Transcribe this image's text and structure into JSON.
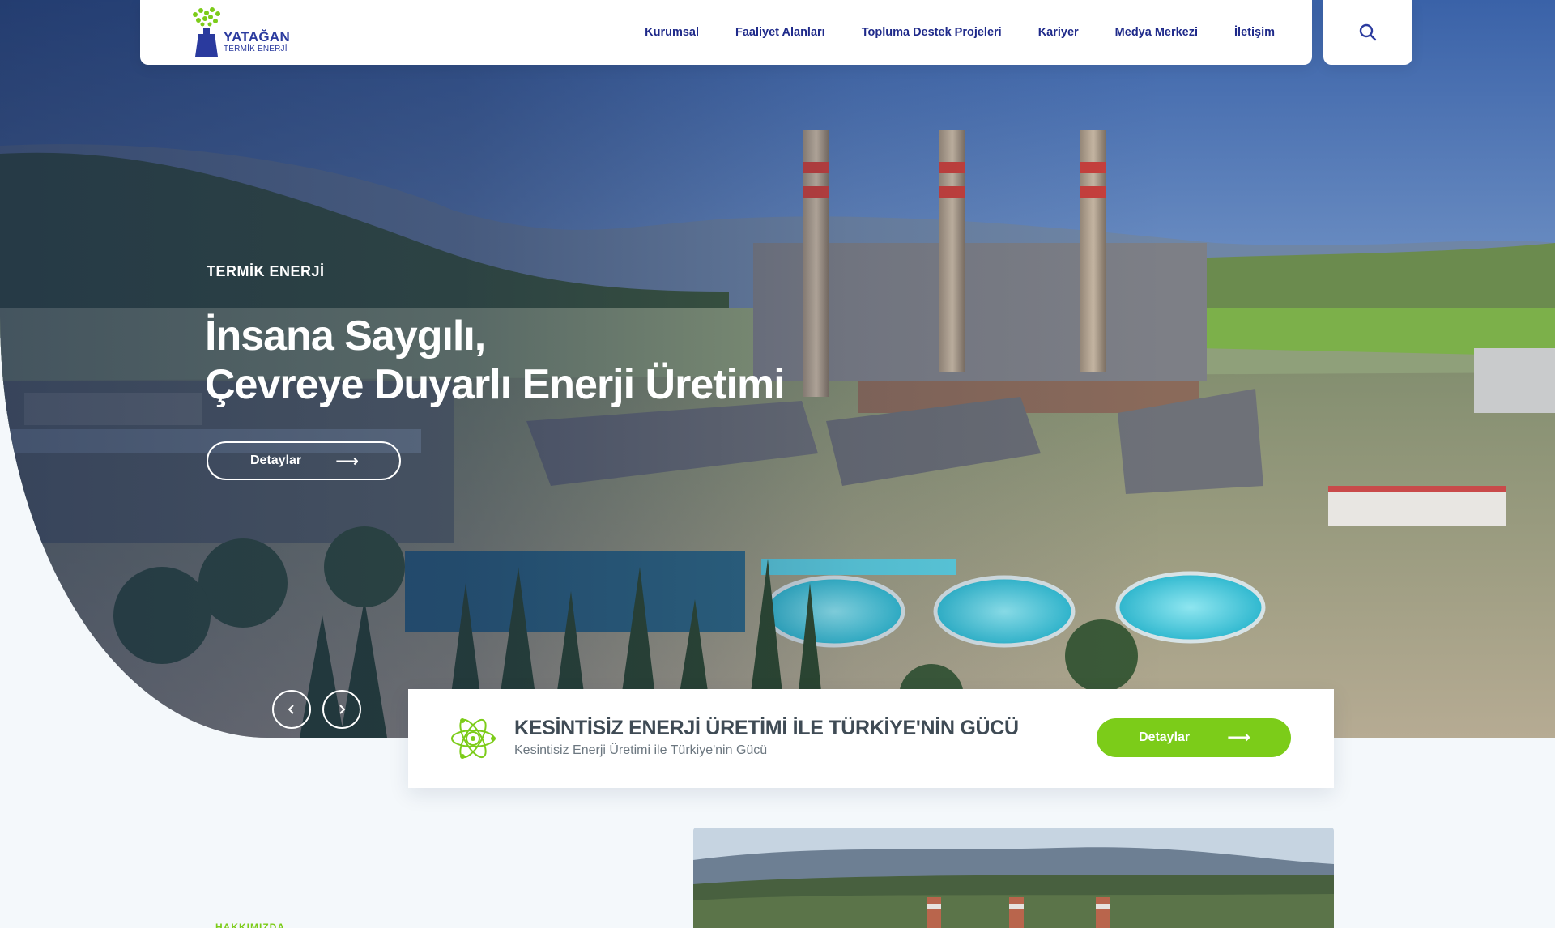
{
  "brand": {
    "name": "YATAĞAN",
    "sub": "TERMİK ENERJİ",
    "colors": {
      "primary": "#1f2a8a",
      "accent": "#7ccc19"
    }
  },
  "nav": {
    "items": [
      {
        "label": "Kurumsal"
      },
      {
        "label": "Faaliyet Alanları"
      },
      {
        "label": "Topluma Destek Projeleri"
      },
      {
        "label": "Kariyer"
      },
      {
        "label": "Medya Merkezi"
      },
      {
        "label": "İletişim"
      }
    ],
    "search_icon": "search-icon"
  },
  "hero": {
    "eyebrow": "TERMİK ENERJİ",
    "title_line1": "İnsana Saygılı,",
    "title_line2": "Çevreye Duyarlı Enerji Üretimi",
    "button_label": "Detaylar",
    "prev_icon": "chevron-left-icon",
    "next_icon": "chevron-right-icon"
  },
  "feature": {
    "icon": "atom-icon",
    "title": "KESİNTİSİZ ENERJİ ÜRETİMİ İLE TÜRKİYE'NİN GÜCÜ",
    "subtitle": "Kesintisiz Enerji Üretimi ile Türkiye'nin Gücü",
    "button_label": "Detaylar"
  },
  "section": {
    "tag": "HAKKIMIZDA"
  }
}
